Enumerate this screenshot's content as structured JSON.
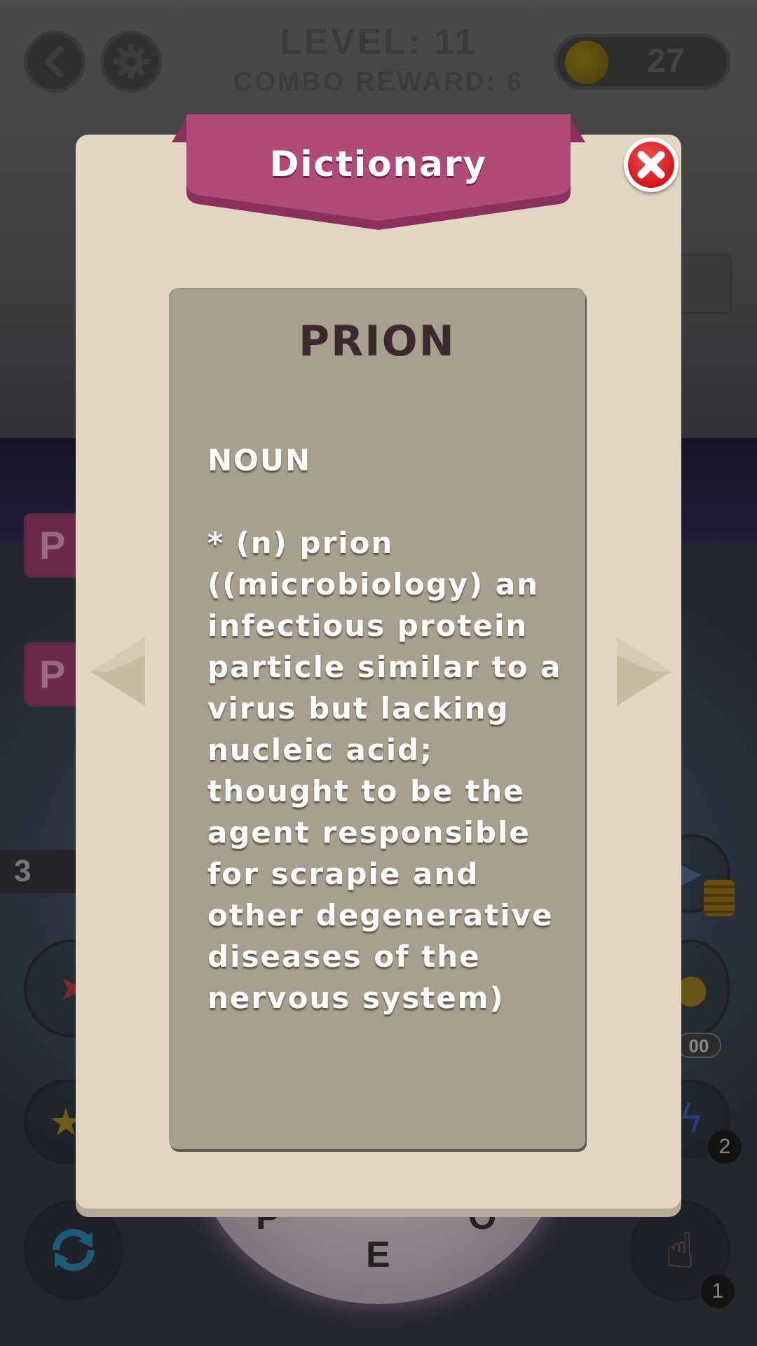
{
  "header": {
    "level_text": "LEVEL: 11",
    "combo_text": "COMBO REWARD: 6",
    "coins": "27"
  },
  "background": {
    "tile_letters": [
      "P",
      "P"
    ],
    "hint_count": "3",
    "pill_value": "00",
    "badges": [
      "2",
      "1"
    ],
    "wheel_letters": [
      "P",
      "O",
      "E"
    ]
  },
  "dictionary": {
    "title": "Dictionary",
    "word": "PRION",
    "part_of_speech": "NOUN",
    "definition": "* (n) prion ((microbiology) an infectious protein particle similar to a virus but lacking nucleic acid; thought to be the agent responsible for scrapie and other degenerative diseases of the nervous system)"
  },
  "colors": {
    "ribbon": "#b04a78",
    "modal_bg": "#e0d6c1",
    "card_bg": "#a7a08e",
    "close_red": "#d81e22"
  }
}
